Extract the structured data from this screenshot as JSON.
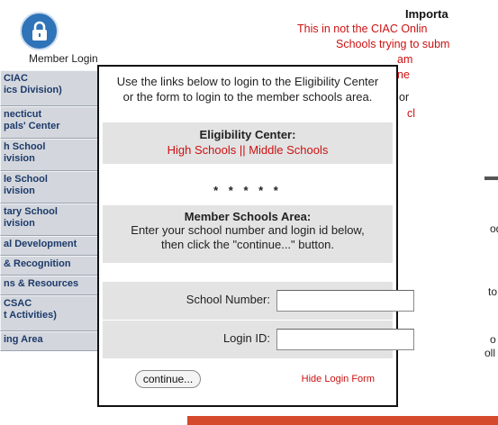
{
  "background": {
    "member_login_label": "Member Login",
    "sidebar_items": [
      "CIAC\nics Division)",
      "necticut\npals' Center",
      "h School\nivision",
      "le School\nivision",
      "tary School\nivision",
      "al Development",
      "& Recognition",
      "ns & Resources",
      "CSAC\nt Activities)",
      "ing Area"
    ],
    "notice": {
      "title": "Importa",
      "lines": [
        "This in not the CIAC Onlin",
        "Schools trying to subm",
        "am",
        "ne",
        "or",
        "cl"
      ]
    },
    "fragments": [
      "od",
      "to",
      "o",
      "oll"
    ],
    "colors": {
      "accent_red": "#cc1111",
      "lock_blue": "#2f73b8",
      "sidebar_bg": "#d3d7dd"
    }
  },
  "popup": {
    "intro": "Use the links below to login to the Eligibility Center\nor the form to login to the member schools area.",
    "eligibility_title": "Eligibility Center:",
    "high_schools_link": "High Schools",
    "links_separator": " || ",
    "middle_schools_link": "Middle Schools",
    "stars": "* * * * *",
    "member_title": "Member Schools Area:",
    "member_text": "Enter your school number and login id below,\nthen click the \"continue...\" button.",
    "school_number_label": "School Number:",
    "school_number_value": "",
    "login_id_label": "Login ID:",
    "login_id_value": "",
    "continue_label": "continue...",
    "hide_link": "Hide Login Form"
  }
}
